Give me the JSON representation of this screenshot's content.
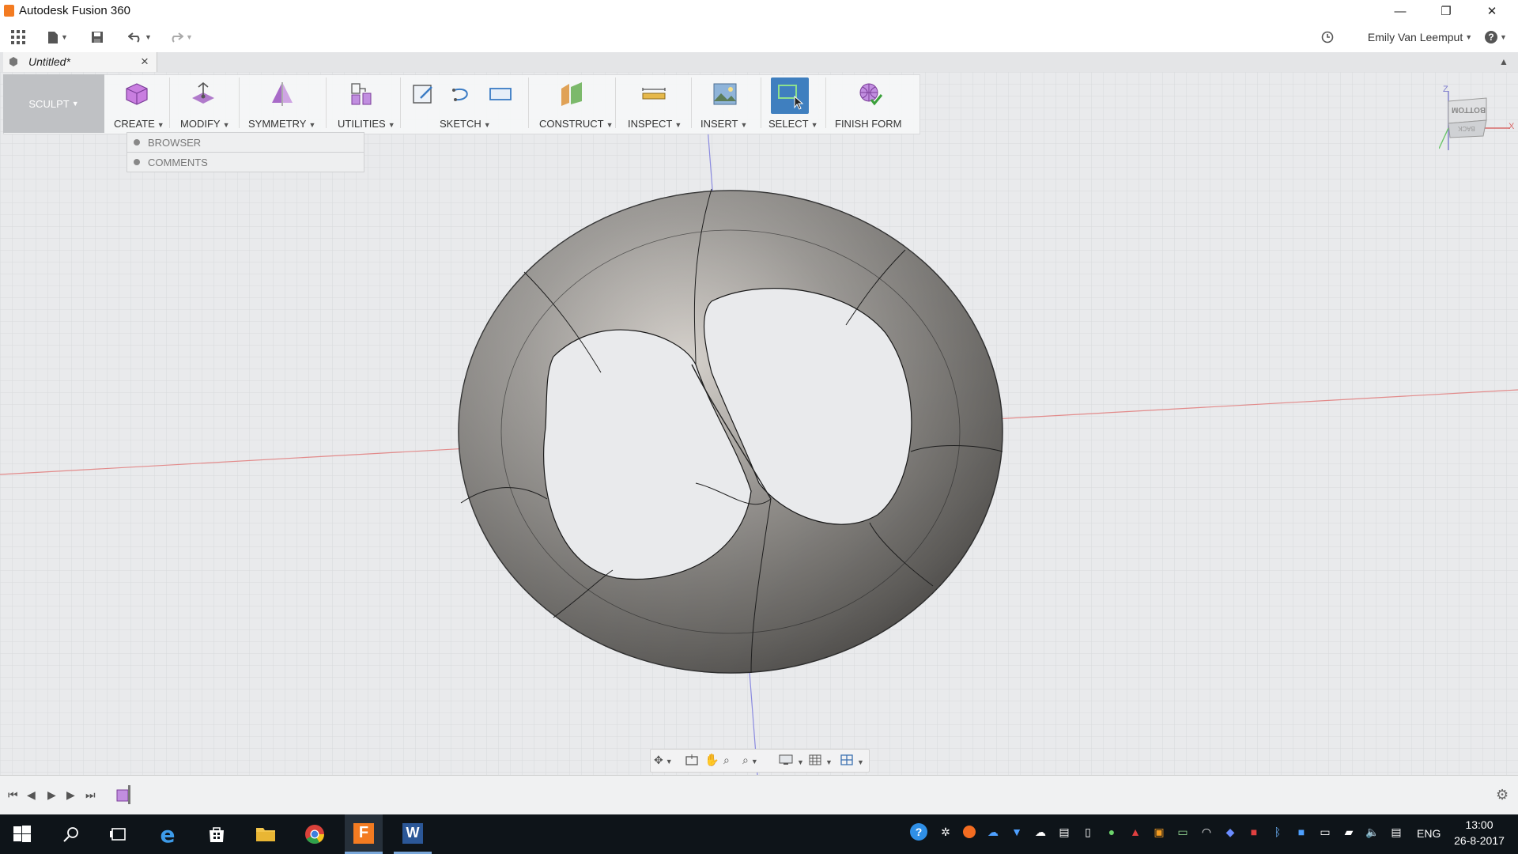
{
  "window": {
    "title": "Autodesk Fusion 360",
    "minimize": "—",
    "restore": "❐",
    "close": "✕"
  },
  "qab": {
    "user": "Emily Van Leemput",
    "help": "?"
  },
  "document_tab": {
    "label": "Untitled*",
    "close": "×"
  },
  "workspace": {
    "label": "SCULPT"
  },
  "toolbar": {
    "groups": [
      {
        "label": "CREATE"
      },
      {
        "label": "MODIFY"
      },
      {
        "label": "SYMMETRY"
      },
      {
        "label": "UTILITIES"
      },
      {
        "label": "SKETCH"
      },
      {
        "label": "CONSTRUCT"
      },
      {
        "label": "INSPECT"
      },
      {
        "label": "INSERT"
      },
      {
        "label": "SELECT"
      },
      {
        "label": "FINISH FORM"
      }
    ]
  },
  "browser": {
    "rows": [
      {
        "label": "BROWSER"
      },
      {
        "label": "COMMENTS"
      }
    ]
  },
  "viewcube": {
    "face": "BOTTOM",
    "edge": "BACK",
    "axis_z": "Z",
    "axis_x": "X"
  },
  "taskbar": {
    "language": "ENG",
    "time": "13:00",
    "date": "26-8-2017"
  },
  "colors": {
    "accent_select": "#3f7fbf",
    "workspace_bg": "#bfc1c4",
    "taskbar": "#0e1419"
  }
}
